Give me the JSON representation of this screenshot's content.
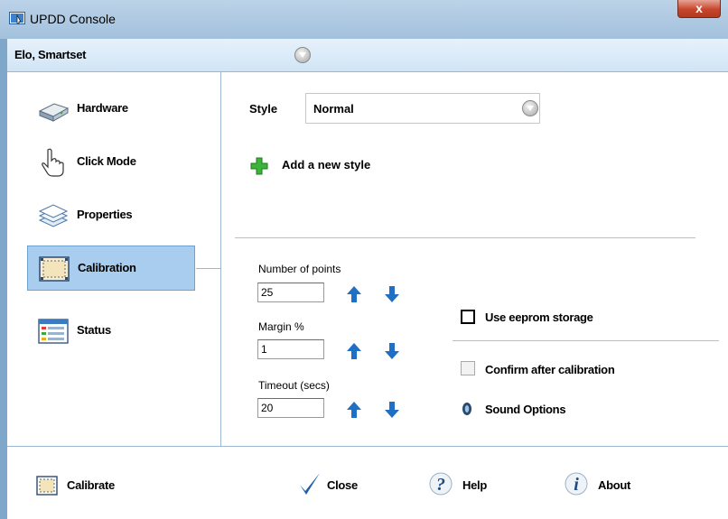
{
  "window": {
    "title": "UPDD Console",
    "close_glyph": "x"
  },
  "device": {
    "name": "Elo, Smartset"
  },
  "sidebar": {
    "items": [
      {
        "label": "Hardware",
        "icon": "hardware-icon"
      },
      {
        "label": "Click Mode",
        "icon": "hand-pointer-icon"
      },
      {
        "label": "Properties",
        "icon": "layers-icon"
      },
      {
        "label": "Calibration",
        "icon": "calibration-icon",
        "active": true
      },
      {
        "label": "Status",
        "icon": "status-icon"
      }
    ]
  },
  "style": {
    "label": "Style",
    "value": "Normal"
  },
  "add_style": {
    "label": "Add a new style"
  },
  "calibration": {
    "points": {
      "label": "Number of points",
      "value": "25"
    },
    "margin": {
      "label": "Margin %",
      "value": "1"
    },
    "timeout": {
      "label": "Timeout (secs)",
      "value": "20"
    },
    "eeprom": {
      "label": "Use eeprom storage",
      "checked": false
    },
    "confirm": {
      "label": "Confirm after calibration",
      "checked": false,
      "enabled": false
    },
    "sound": {
      "label": "Sound Options"
    }
  },
  "footer": {
    "calibrate": "Calibrate",
    "close": "Close",
    "help": "Help",
    "about": "About"
  },
  "colors": {
    "accent": "#a9cdee",
    "arrow": "#1e6fc6",
    "green_plus": "#2ca02c"
  }
}
